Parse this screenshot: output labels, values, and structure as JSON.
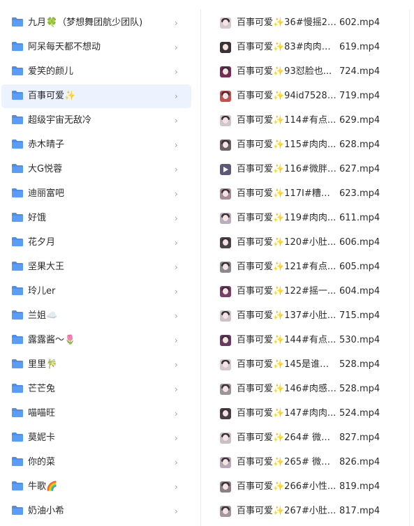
{
  "colors": {
    "folder": "#5b9cf5",
    "folder_tab": "#4a8ef0",
    "selected_bg": "#ecf2fe",
    "chevron": "#9aa0a8"
  },
  "folder_list": {
    "chevron_glyph": "›",
    "selected_index": 3,
    "items": [
      {
        "label": "九月🍀（梦想舞团航少团队)"
      },
      {
        "label": "阿呆每天都不想动"
      },
      {
        "label": "爱笑的颜儿"
      },
      {
        "label": "百事可爱✨"
      },
      {
        "label": "超级宇宙无敌冷"
      },
      {
        "label": "赤木晴子"
      },
      {
        "label": "大G悦蓉"
      },
      {
        "label": "迪丽富吧"
      },
      {
        "label": "好饿"
      },
      {
        "label": "花夕月"
      },
      {
        "label": "坚果大王"
      },
      {
        "label": "玲儿er"
      },
      {
        "label": "兰姐☁️"
      },
      {
        "label": "露露酱～🌷"
      },
      {
        "label": "里里🎋"
      },
      {
        "label": "芒芒兔"
      },
      {
        "label": "喵喵旺"
      },
      {
        "label": "莫妮卡"
      },
      {
        "label": "你的菜"
      },
      {
        "label": "牛歌🌈"
      },
      {
        "label": "奶油小希"
      }
    ]
  },
  "file_list": {
    "items": [
      {
        "name": "百事可爱✨36#慢摇20...",
        "ext": "602.mp4",
        "thumb": "#d8c9cf"
      },
      {
        "name": "百事可爱✨83#肉肉女...",
        "ext": "619.mp4",
        "thumb": "#3a3238"
      },
      {
        "name": "百事可爱✨93怼脸也...",
        "ext": "724.mp4",
        "thumb": "#7a2a55"
      },
      {
        "name": "百事可爱✨94id75284...",
        "ext": "719.mp4",
        "thumb": "#c2504e"
      },
      {
        "name": "百事可爱✨114#有点...",
        "ext": "629.mp4",
        "thumb": "#cfc7cc"
      },
      {
        "name": "百事可爱✨115#肉肉...",
        "ext": "628.mp4",
        "thumb": "#6b6266"
      },
      {
        "name": "百事可爱✨116#微胖y...",
        "ext": "627.mp4",
        "thumb": "#5c5a78"
      },
      {
        "name": "百事可爱✨117I#糟糕...",
        "ext": "623.mp4",
        "thumb": "#a88d96"
      },
      {
        "name": "百事可爱✨119#肉肉...",
        "ext": "611.mp4",
        "thumb": "#b9aebd"
      },
      {
        "name": "百事可爱✨120#小肚...",
        "ext": "606.mp4",
        "thumb": "#4c4448"
      },
      {
        "name": "百事可爱✨121#有点...",
        "ext": "605.mp4",
        "thumb": "#8d8790"
      },
      {
        "name": "百事可爱✨122#摇一...",
        "ext": "604.mp4",
        "thumb": "#7b3c6a"
      },
      {
        "name": "百事可爱✨137#小肚...",
        "ext": "715.mp4",
        "thumb": "#cbc3c7"
      },
      {
        "name": "百事可爱✨144#有点...",
        "ext": "530.mp4",
        "thumb": "#6a3a62"
      },
      {
        "name": "百事可爱✨145是谁开...",
        "ext": "528.mp4",
        "thumb": "#d3c9cc"
      },
      {
        "name": "百事可爱✨146#肉感2...",
        "ext": "528.mp4",
        "thumb": "#9b9498"
      },
      {
        "name": "百事可爱✨147#肉肉...",
        "ext": "524.mp4",
        "thumb": "#4a3f46"
      },
      {
        "name": "百事可爱✨264# 微胖...",
        "ext": "827.mp4",
        "thumb": "#c9bfc4"
      },
      {
        "name": "百事可爱✨265# 微胖...",
        "ext": "826.mp4",
        "thumb": "#b7a9b6"
      },
      {
        "name": "百事可爱✨266#小性...",
        "ext": "819.mp4",
        "thumb": "#8c7f86"
      },
      {
        "name": "百事可爱✨267#小肚...",
        "ext": "817.mp4",
        "thumb": "#a3969d"
      }
    ]
  }
}
